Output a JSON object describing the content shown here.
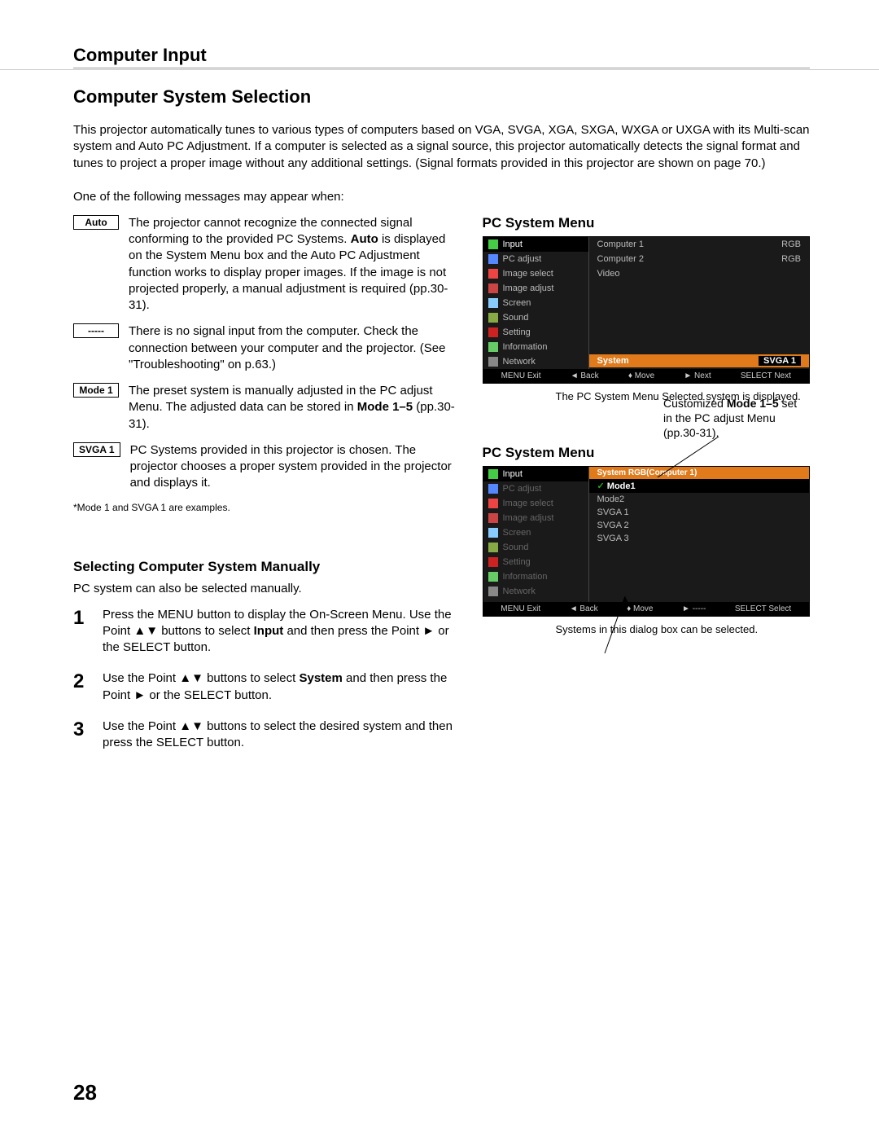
{
  "header": "Computer Input",
  "title": "Computer System Selection",
  "intro": "This projector automatically tunes to various types of computers based on VGA, SVGA, XGA, SXGA, WXGA or UXGA with its Multi-scan system and Auto PC Adjustment. If a computer is selected as a signal source, this projector automatically detects the signal format and tunes to project a proper image without any additional settings. (Signal formats provided in this projector are shown on page 70.)",
  "lead": "One of the following messages may appear when:",
  "msgs": [
    {
      "tag": "Auto",
      "text_pre": "The projector cannot recognize the connected signal conforming to the provided PC Systems. ",
      "text_bold": "Auto",
      "text_post": " is displayed on the System Menu box and the Auto PC Adjustment function works to display proper images. If the image is not projected properly, a manual adjustment is required (pp.30-31)."
    },
    {
      "tag": "-----",
      "text_pre": "There is no signal input from the computer. Check the connection between your computer and the projector. (See \"Troubleshooting\" on p.63.)",
      "text_bold": "",
      "text_post": ""
    },
    {
      "tag": "Mode 1",
      "text_pre": "The preset system is manually adjusted in the PC adjust Menu. The adjusted data can be stored in ",
      "text_bold": "Mode 1–5",
      "text_post": " (pp.30-31)."
    },
    {
      "tag": "SVGA 1",
      "text_pre": "PC Systems provided in this projector is chosen. The projector chooses a proper system provided in the projector and displays it.",
      "text_bold": "",
      "text_post": ""
    }
  ],
  "footnote": "*Mode 1 and SVGA 1 are examples.",
  "manual_title": "Selecting Computer System Manually",
  "manual_sub": "PC system can also be selected manually.",
  "steps": [
    {
      "n": "1",
      "pre": "Press the MENU button to display the On-Screen Menu. Use the Point ▲▼ buttons to select ",
      "b": "Input",
      "post": " and then press the Point ► or the SELECT button."
    },
    {
      "n": "2",
      "pre": "Use the Point ▲▼ buttons to select ",
      "b": "System",
      "post": " and then press the Point ► or the SELECT button."
    },
    {
      "n": "3",
      "pre": "Use the Point ▲▼ buttons to select the desired system and then press the SELECT button.",
      "b": "",
      "post": ""
    }
  ],
  "right1_title": "PC System Menu",
  "osd_side": [
    {
      "label": "Input",
      "color": "#4c4",
      "sel": true
    },
    {
      "label": "PC adjust",
      "color": "#58f",
      "sel": false
    },
    {
      "label": "Image select",
      "color": "#e44",
      "sel": false
    },
    {
      "label": "Image adjust",
      "color": "#c44",
      "sel": false
    },
    {
      "label": "Screen",
      "color": "#8cf",
      "sel": false
    },
    {
      "label": "Sound",
      "color": "#8a4",
      "sel": false
    },
    {
      "label": "Setting",
      "color": "#c22",
      "sel": false
    },
    {
      "label": "Information",
      "color": "#6c6",
      "sel": false
    },
    {
      "label": "Network",
      "color": "#888",
      "sel": false
    }
  ],
  "osd_inputs": [
    {
      "name": "Computer 1",
      "sig": "RGB"
    },
    {
      "name": "Computer 2",
      "sig": "RGB"
    },
    {
      "name": "Video",
      "sig": ""
    }
  ],
  "osd_sysbar": {
    "left": "System",
    "right": "SVGA 1"
  },
  "osd_foot1": [
    "MENU Exit",
    "◄ Back",
    "♦ Move",
    "► Next",
    "SELECT Next"
  ],
  "caption1": "The PC System Menu Selected system is displayed.",
  "anno_top_pre": "Customized ",
  "anno_top_b": "Mode 1–5",
  "anno_top_post": " set in the PC adjust Menu (pp.30-31).",
  "right2_title": "PC System Menu",
  "osd2_header": "System      RGB(Computer 1)",
  "osd2_list": [
    {
      "label": "Mode1",
      "sel": true
    },
    {
      "label": "Mode2",
      "sel": false
    },
    {
      "label": "SVGA 1",
      "sel": false
    },
    {
      "label": "SVGA 2",
      "sel": false
    },
    {
      "label": "SVGA 3",
      "sel": false
    }
  ],
  "osd_foot2": [
    "MENU Exit",
    "◄ Back",
    "♦ Move",
    "► -----",
    "SELECT Select"
  ],
  "caption2": "Systems in this dialog box can be selected.",
  "page_num": "28"
}
